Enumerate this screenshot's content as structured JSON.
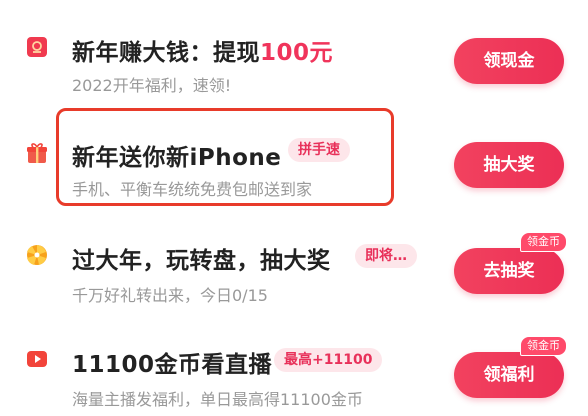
{
  "tasks": [
    {
      "title_main": "新年赚大钱：提现",
      "title_highlight": "100元",
      "subtitle": "2022开年福利，速领!",
      "button": "领现金"
    },
    {
      "title_main": "新年送你新iPhone",
      "tag": "拼手速",
      "subtitle": "手机、平衡车统统免费包邮送到家",
      "button": "抽大奖"
    },
    {
      "title_main": "过大年，玩转盘，抽大奖",
      "tag": "即将…",
      "subtitle": "千万好礼转出来，今日0/15",
      "button": "去抽奖",
      "badge": "领金币"
    },
    {
      "title_main": "11100金币看直播",
      "tag": "最高+11100",
      "subtitle": "海量主播发福利，单日最高得11100金币",
      "button": "领福利",
      "badge": "领金币"
    }
  ]
}
